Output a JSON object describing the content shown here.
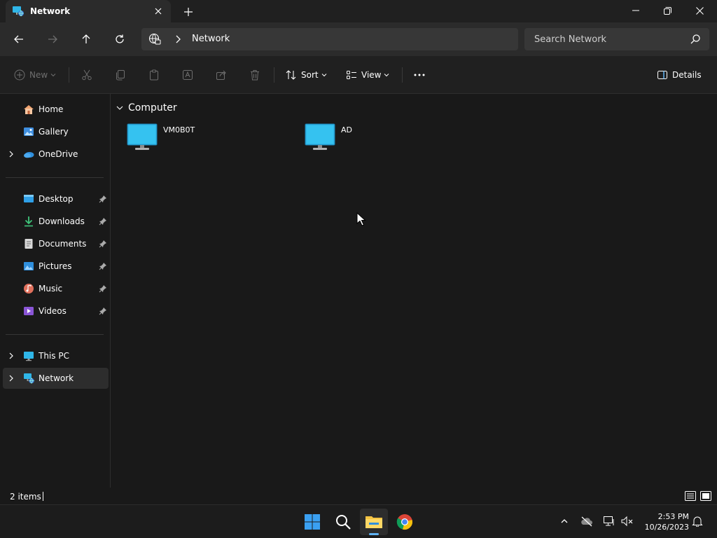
{
  "window": {
    "tab_title": "Network",
    "controls": [
      "minimize",
      "maximize",
      "close"
    ]
  },
  "navigation": {
    "breadcrumb": [
      "Network"
    ],
    "search_placeholder": "Search Network"
  },
  "commandbar": {
    "new_label": "New",
    "sort_label": "Sort",
    "view_label": "View",
    "details_label": "Details"
  },
  "sidebar": {
    "top": [
      {
        "label": "Home",
        "icon": "home-icon"
      },
      {
        "label": "Gallery",
        "icon": "gallery-icon"
      },
      {
        "label": "OneDrive",
        "icon": "onedrive-icon",
        "expandable": true
      }
    ],
    "quick_access": [
      {
        "label": "Desktop",
        "icon": "desktop-icon"
      },
      {
        "label": "Downloads",
        "icon": "downloads-icon"
      },
      {
        "label": "Documents",
        "icon": "documents-icon"
      },
      {
        "label": "Pictures",
        "icon": "pictures-icon"
      },
      {
        "label": "Music",
        "icon": "music-icon"
      },
      {
        "label": "Videos",
        "icon": "videos-icon"
      }
    ],
    "bottom": [
      {
        "label": "This PC",
        "icon": "this-pc-icon",
        "expandable": true
      },
      {
        "label": "Network",
        "icon": "network-icon",
        "expandable": true,
        "selected": true
      }
    ]
  },
  "content": {
    "group_label": "Computer",
    "items": [
      {
        "name": "VM0B0T",
        "icon": "computer-icon"
      },
      {
        "name": "AD",
        "icon": "computer-icon"
      }
    ]
  },
  "status": {
    "item_count": "2 items"
  },
  "taskbar": {
    "apps": [
      "start-icon",
      "search-icon",
      "file-explorer-icon",
      "chrome-icon"
    ],
    "time": "2:53 PM",
    "date": "10/26/2023"
  },
  "colors": {
    "accent": "#5fb2f2",
    "monitor": "#2fb6e8",
    "selected_bg": "#2d2d2d"
  }
}
